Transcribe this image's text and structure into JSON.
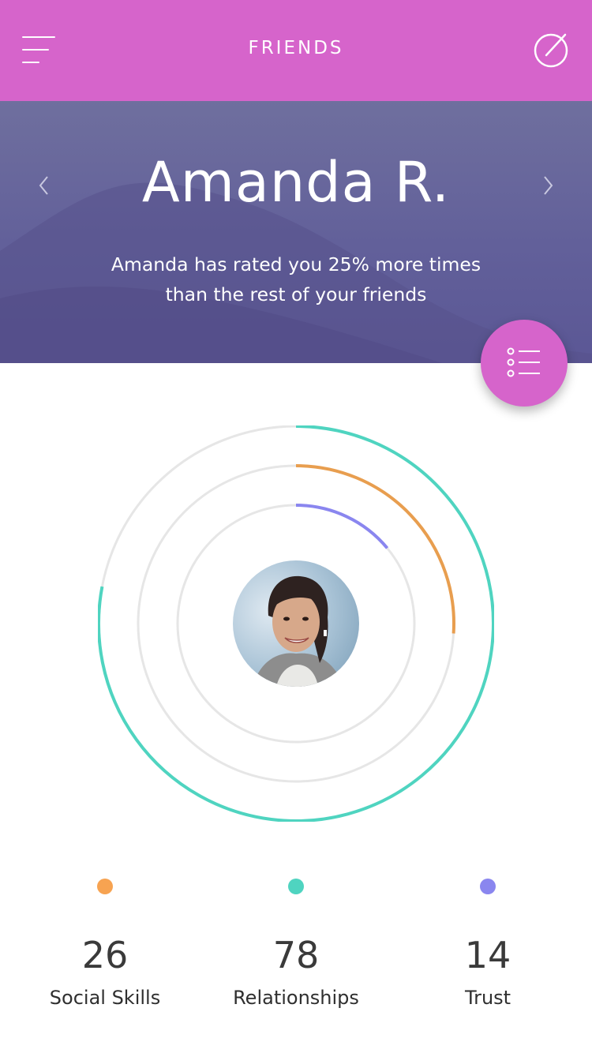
{
  "header": {
    "title": "FRIENDS",
    "menu_icon": "hamburger-menu-icon",
    "action_icon": "compose-icon",
    "background": "#d664cb"
  },
  "profile": {
    "name": "Amanda R.",
    "description_line1": "Amanda has rated you 25% more times",
    "description_line2": "than the rest of your friends",
    "prev_icon": "chevron-left-icon",
    "next_icon": "chevron-right-icon"
  },
  "fab": {
    "icon": "list-icon",
    "color": "#d664cb"
  },
  "rings": {
    "track_color": "#e6e6e6",
    "series": [
      {
        "key": "relationships",
        "color": "#4fd4c0",
        "fraction": 0.78
      },
      {
        "key": "social_skills",
        "color": "#e89e4f",
        "fraction": 0.26
      },
      {
        "key": "trust",
        "color": "#8a86ef",
        "fraction": 0.14
      }
    ]
  },
  "stats": [
    {
      "value": "26",
      "label": "Social Skills",
      "color": "#f7a351"
    },
    {
      "value": "78",
      "label": "Relationships",
      "color": "#4fd4c0"
    },
    {
      "value": "14",
      "label": "Trust",
      "color": "#8a86ef"
    }
  ]
}
